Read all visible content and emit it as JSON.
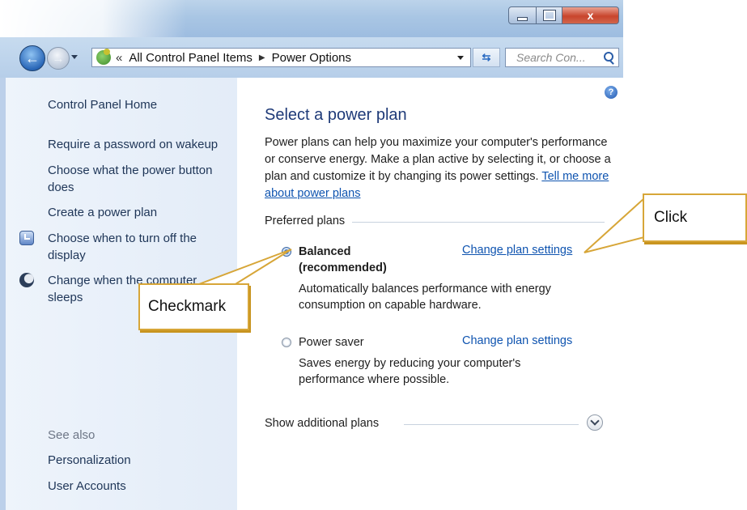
{
  "window": {
    "buttons": {
      "minimize": "minimize",
      "maximize": "maximize",
      "close": "x"
    }
  },
  "navbar": {
    "address_prefix": "«",
    "breadcrumb": [
      "All Control Panel Items",
      "Power Options"
    ],
    "search_placeholder": "Search Con..."
  },
  "sidebar": {
    "home": "Control Panel Home",
    "links": [
      "Require a password on wakeup",
      "Choose what the power button does",
      "Create a power plan",
      "Choose when to turn off the display",
      "Change when the computer sleeps"
    ],
    "see_also": {
      "heading": "See also",
      "links": [
        "Personalization",
        "User Accounts"
      ]
    }
  },
  "main": {
    "help": "?",
    "title": "Select a power plan",
    "intro": "Power plans can help you maximize your computer's performance or conserve energy. Make a plan active by selecting it, or choose a plan and customize it by changing its power settings.",
    "intro_link": "Tell me more about power plans",
    "preferred_plans_heading": "Preferred plans",
    "plans": [
      {
        "name_line1": "Balanced",
        "name_line2": "(recommended)",
        "selected": true,
        "settings_link": "Change plan settings",
        "description": "Automatically balances performance with energy consumption on capable hardware."
      },
      {
        "name_line1": "Power saver",
        "selected": false,
        "settings_link": "Change plan settings",
        "description": "Saves energy by reducing your computer's performance where possible."
      }
    ],
    "show_additional": "Show additional plans"
  },
  "annotations": {
    "checkmark": "Checkmark",
    "click": "Click"
  },
  "colors": {
    "link": "#0f54b0",
    "title": "#1e3a78",
    "callout_border": "#d7a638",
    "sidebar_bg": "#e9f1fb"
  }
}
